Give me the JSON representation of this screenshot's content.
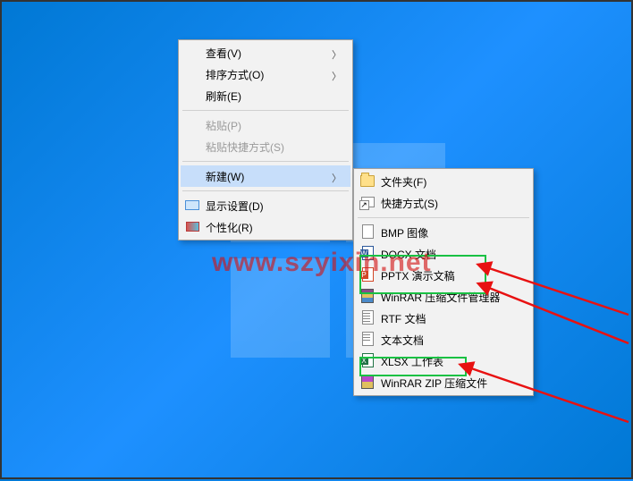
{
  "watermark": "www.szyixin.net",
  "mainMenu": {
    "view": "查看(V)",
    "sort": "排序方式(O)",
    "refresh": "刷新(E)",
    "paste": "粘贴(P)",
    "pasteShortcut": "粘贴快捷方式(S)",
    "new": "新建(W)",
    "display": "显示设置(D)",
    "personalize": "个性化(R)"
  },
  "subMenu": {
    "folder": "文件夹(F)",
    "shortcut": "快捷方式(S)",
    "bmp": "BMP 图像",
    "docx": "DOCX 文档",
    "pptx": "PPTX 演示文稿",
    "winrar": "WinRAR 压缩文件管理器",
    "rtf": "RTF 文档",
    "txt": "文本文档",
    "xlsx": "XLSX 工作表",
    "winrarzip": "WinRAR ZIP 压缩文件"
  }
}
